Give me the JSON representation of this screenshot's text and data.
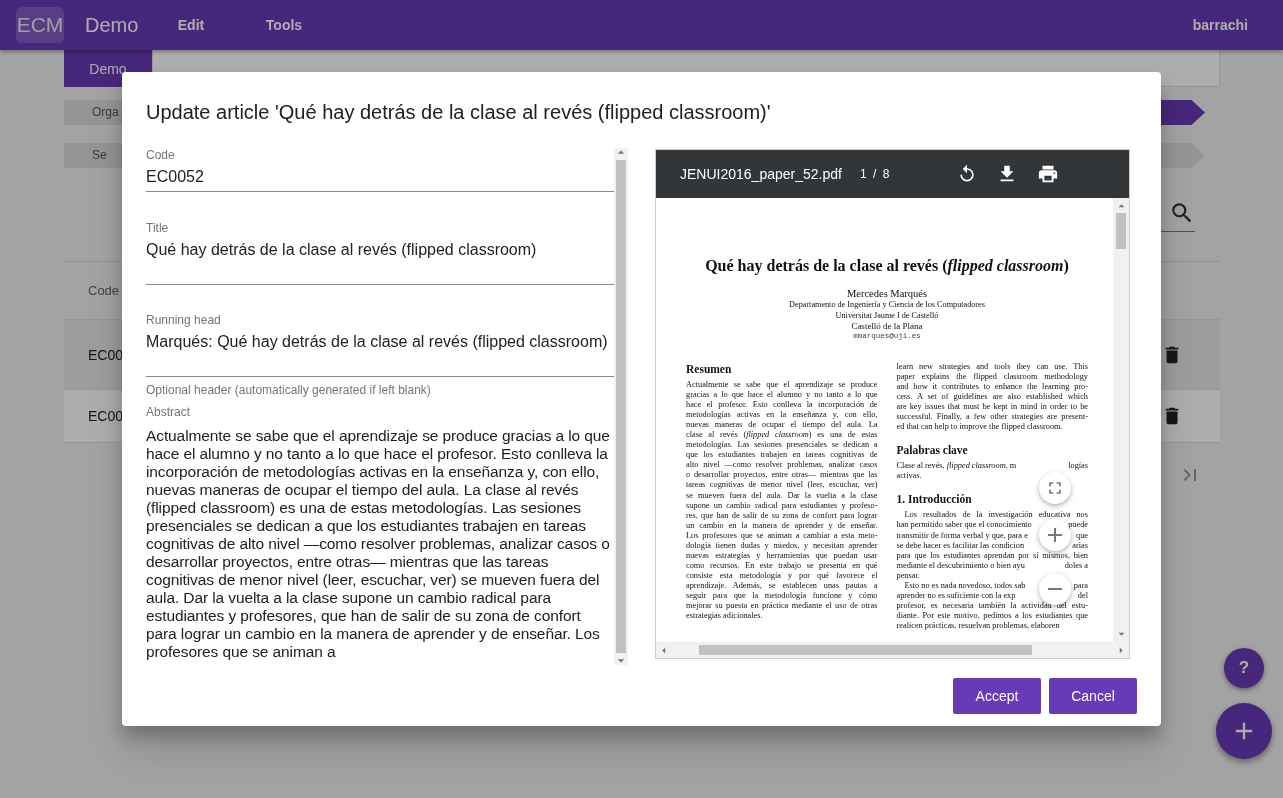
{
  "app_bar": {
    "logo": "ECM",
    "title": "Demo",
    "menus": [
      "Edit",
      "Tools"
    ],
    "user": "barrachi"
  },
  "background": {
    "tabs": [
      {
        "label": "Demo",
        "selected": true
      }
    ],
    "chips": [
      {
        "label": "Orga",
        "selected": true
      },
      {
        "label": "Se",
        "selected": false
      }
    ],
    "table": {
      "columns": [
        "Code"
      ],
      "rows": [
        {
          "code": "EC00",
          "selected": true
        },
        {
          "code": "EC00",
          "selected": false
        }
      ]
    },
    "help_button": "?"
  },
  "dialog": {
    "title": "Update article 'Qué hay detrás de la clase al revés (flipped classroom)'",
    "fields": [
      {
        "kind": "input",
        "label": "Code",
        "value": "EC0052"
      },
      {
        "kind": "textarea",
        "label": "Title",
        "value": "Qué hay detrás de la clase al revés (flipped classroom)"
      },
      {
        "kind": "textarea",
        "label": "Running head",
        "value": "Marqués: Qué hay detrás de la clase al revés (flipped classroom)",
        "hint": "Optional header (automatically generated if left blank)"
      },
      {
        "kind": "long_text",
        "label": "Abstract",
        "value": "Actualmente se sabe que el aprendizaje se produce gracias a lo que hace el alumno y no tanto a lo que hace el profesor. Esto conlleva la incorporación de metodologías activas en la enseñanza y, con ello, nuevas maneras de ocupar el tiempo del aula. La clase al revés (flipped classroom) es una de estas metodologías. Las sesiones presenciales se dedican a que los estudiantes trabajen en tareas cognitivas de alto nivel —como resolver problemas, analizar casos o desarrollar proyectos, entre otras— mientras que las tareas cognitivas de menor nivel (leer, escuchar, ver) se mueven fuera del aula. Dar la vuelta a la clase supone un cambio radical para estudiantes y profesores, que han de salir de su zona de confort para lograr un cambio en la manera de aprender y de enseñar. Los profesores que se animan a"
      }
    ],
    "pdf": {
      "file_name": "JENUI2016_paper_52.pdf",
      "page_indicator": "1 / 8",
      "page": {
        "title": "Qué hay detrás de la clase al revés (*flipped classroom*)",
        "author": "Mercedes Marqués",
        "affiliation": [
          "Departamento de Ingeniería y Ciencia de los Computadores",
          "Universitat Jaume I de Castelló",
          "Castelló de la Plana"
        ],
        "email": "mmarques@uji.es",
        "columns": [
          [
            {
              "kind": "heading",
              "text": "Resumen"
            },
            {
              "kind": "paragraph",
              "indent": false,
              "lines": [
                "Actualmente se sabe que el aprendizaje se produce",
                "gracias a lo que hace el alumno y no tanto a lo que",
                "hace el profesor. Esto conlleva la incorporación de",
                "metodologías activas en la enseñanza y, con ello,",
                "nuevas maneras de ocupar el tiempo del aula. La",
                "clase al revés (*flipped classroom*) es una de estas",
                "metodologías. Las sesiones presenciales se dedican a",
                "que los estudiantes trabajen en tareas cognitivas de",
                "alto nivel —como resolver problemas, analizar casos",
                "o desarrollar proyectos, entre otras— mientras que las",
                "tareas cognitivas de menor nivel (leer, escuchar, ver)",
                "se mueven fuera del aula. Dar la vuelta a la clase",
                "supone un cambio radical para estudiantes y profeso-",
                "res, que han de salir de su zona de confort para lograr",
                "un cambio en la manera de aprender y de enseñar.",
                "Los profesores que se animan a cambiar a esta meto-",
                "dología tienen dudas y miedos, y necesitan aprender",
                "nuevas estrategias y herramientas que puedan usar",
                "como recursos. En este trabajo se presenta en qué",
                "consiste esta metodología y por qué favorece el",
                "aprendizaje. Además, se establecen unas pautas a",
                "seguir para que la metodología funcione y cómo",
                "mejorar su puesta en práctica mediante el uso de otras",
                "estrategias adicionales."
              ]
            }
          ],
          [
            {
              "kind": "paragraph",
              "indent": false,
              "lines": [
                "learn new strategies and tools they can use. This",
                "paper explains the flipped classroom methodology",
                "and how it contributes to enhance the learning pro-",
                "cess. A set of guidelines are also established which",
                "are key issues that must be kept in mind in order to be",
                "successful. Finally, a few other strategies are present-",
                "ed that can help to improve the flipped classroom."
              ]
            },
            {
              "kind": "heading",
              "text": "Palabras clave"
            },
            {
              "kind": "paragraph",
              "indent": false,
              "lines": [
                [
                  "Clase al revés, *flipped classroom*, m",
                  "logías"
                ],
                "activas."
              ]
            },
            {
              "kind": "heading",
              "text": "1. Introducción"
            },
            {
              "kind": "paragraph",
              "indent": true,
              "lines": [
                "Los resultados de la investigación educativa nos",
                [
                  "han permitido saber que el conocimiento",
                  "puede"
                ],
                [
                  "transmitir de forma verbal y que, para e",
                  "que"
                ],
                [
                  "se debe hacer es facilitar las condicion",
                  "arias"
                ],
                "para que los estudiantes aprendan por sí mismos, bien",
                [
                  "mediante el descubrimiento o bien ayu",
                  "doles a"
                ],
                "pensar."
              ]
            },
            {
              "kind": "paragraph",
              "indent": true,
              "lines": [
                [
                  "Esto no es nada novedoso, todos sab",
                  "para"
                ],
                [
                  "aprender no es suficiente con la exp",
                  "del"
                ],
                "profesor, es necesaria también la actividad del estu-",
                "diante. Por este motivo, pedimos a los estudiantes que",
                "realicen prácticas, resuelvan problemas, elaboren"
              ]
            }
          ]
        ]
      }
    },
    "buttons": [
      "Accept",
      "Cancel"
    ]
  }
}
